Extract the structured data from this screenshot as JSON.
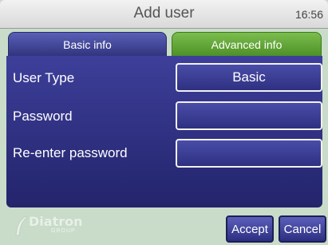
{
  "header": {
    "title": "Add user",
    "time": "16:56"
  },
  "tabs": [
    {
      "label": "Basic info"
    },
    {
      "label": "Advanced info"
    }
  ],
  "form": {
    "user_type": {
      "label": "User Type",
      "value": "Basic"
    },
    "password": {
      "label": "Password",
      "value": ""
    },
    "reenter_password": {
      "label": "Re-enter password",
      "value": ""
    }
  },
  "footer": {
    "logo_text": "Diatron",
    "logo_sub": "GROUP",
    "accept_label": "Accept",
    "cancel_label": "Cancel"
  }
}
